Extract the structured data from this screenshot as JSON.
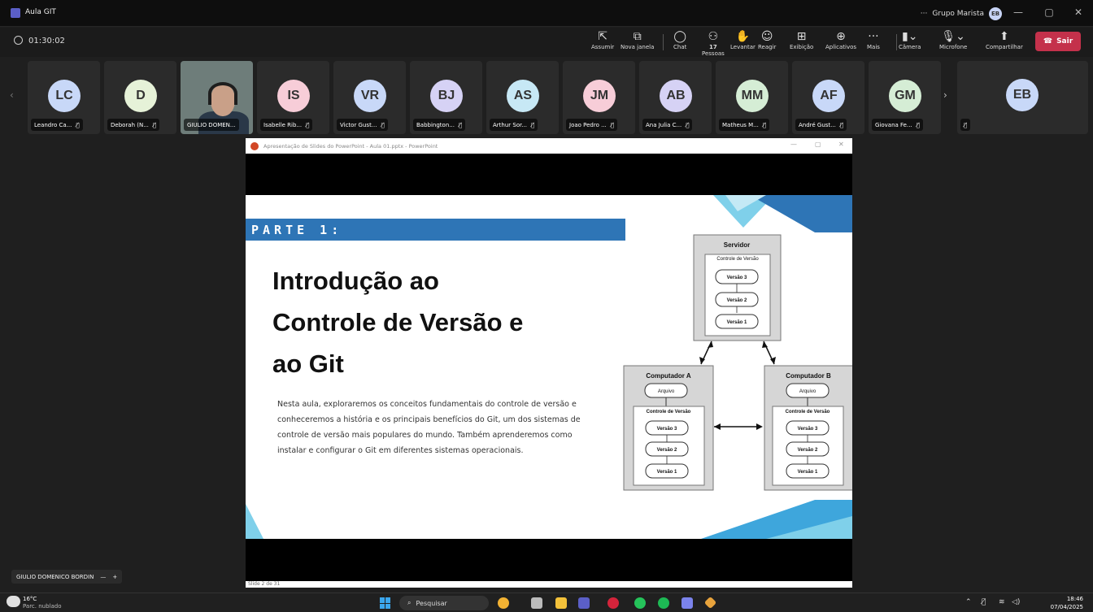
{
  "window": {
    "title": "Aula GIT",
    "org": "Grupo Marista",
    "org_avatar": "EB"
  },
  "meeting": {
    "timer": "01:30:02"
  },
  "toolbar": [
    {
      "name": "assumir-button",
      "label": "Assumir",
      "icon": "⇱"
    },
    {
      "name": "nova-janela-button",
      "label": "Nova janela",
      "icon": "⧉"
    },
    {
      "name": "chat-button",
      "label": "Chat",
      "icon": "◯"
    },
    {
      "name": "pessoas-button",
      "label": "Pessoas",
      "icon": "⚇",
      "badge": "17"
    },
    {
      "name": "levantar-button",
      "label": "Levantar",
      "icon": "✋"
    },
    {
      "name": "reagir-button",
      "label": "Reagir",
      "icon": "☺"
    },
    {
      "name": "exibicao-button",
      "label": "Exibição",
      "icon": "⊞"
    },
    {
      "name": "aplicativos-button",
      "label": "Aplicativos",
      "icon": "⊕"
    },
    {
      "name": "mais-button",
      "label": "Mais",
      "icon": "···"
    },
    {
      "name": "camera-button",
      "label": "Câmera",
      "icon": "▮⌄"
    },
    {
      "name": "microfone-button",
      "label": "Microfone",
      "icon": "🎙⌄"
    },
    {
      "name": "compartilhar-button",
      "label": "Compartilhar",
      "icon": "⬆"
    }
  ],
  "leave_label": "Sair",
  "participants": [
    {
      "initials": "LC",
      "name": "Leandro Ca...",
      "color": "#c8d8f8"
    },
    {
      "initials": "D",
      "name": "Deborah (N...",
      "color": "#e6f2d8"
    },
    {
      "initials": "",
      "name": "GIULIO DOMEN...",
      "color": ""
    },
    {
      "initials": "IS",
      "name": "Isabelle Rib...",
      "color": "#f7cdd8"
    },
    {
      "initials": "VR",
      "name": "Victor Gust...",
      "color": "#c8d8f8"
    },
    {
      "initials": "BJ",
      "name": "Babbington...",
      "color": "#d6d2f5"
    },
    {
      "initials": "AS",
      "name": "Arthur Sor...",
      "color": "#c7e8f5"
    },
    {
      "initials": "JM",
      "name": "Joao Pedro ...",
      "color": "#f7cdd8"
    },
    {
      "initials": "AB",
      "name": "Ana Julia C...",
      "color": "#d6d2f5"
    },
    {
      "initials": "MM",
      "name": "Matheus M...",
      "color": "#d5edd5"
    },
    {
      "initials": "AF",
      "name": "André Gust...",
      "color": "#c8d8f8"
    },
    {
      "initials": "GM",
      "name": "Giovana Fe...",
      "color": "#d5edd5"
    }
  ],
  "overflow_participant": {
    "initials": "EB",
    "color": "#c8d8f8"
  },
  "powerpoint": {
    "title": "Apresentação de Slides do PowerPoint - Aula 01.pptx - PowerPoint"
  },
  "slide": {
    "section": "PARTE 1:",
    "title": [
      "Introdução ao",
      "Controle de Versão e",
      "ao Git"
    ],
    "body": "Nesta aula, exploraremos os conceitos fundamentais do controle de versão e conheceremos a história e os principais benefícios do Git, um dos sistemas de controle de versão mais populares do mundo. Também aprenderemos como instalar e configurar o Git em diferentes sistemas operacionais.",
    "footer": "Slide 2 de 31",
    "diagram": {
      "server": "Servidor",
      "vc": "Controle de Versão",
      "v3": "Versão 3",
      "v2": "Versão 2",
      "v1": "Versão 1",
      "comp_a": "Computador A",
      "comp_b": "Computador B",
      "file": "Arquivo"
    }
  },
  "presenter_name": "GIULIO DOMENICO BORDIN",
  "taskbar": {
    "temp": "16°C",
    "weather": "Parc. nublado",
    "search": "Pesquisar",
    "time": "18:46",
    "date": "07/04/2025"
  }
}
